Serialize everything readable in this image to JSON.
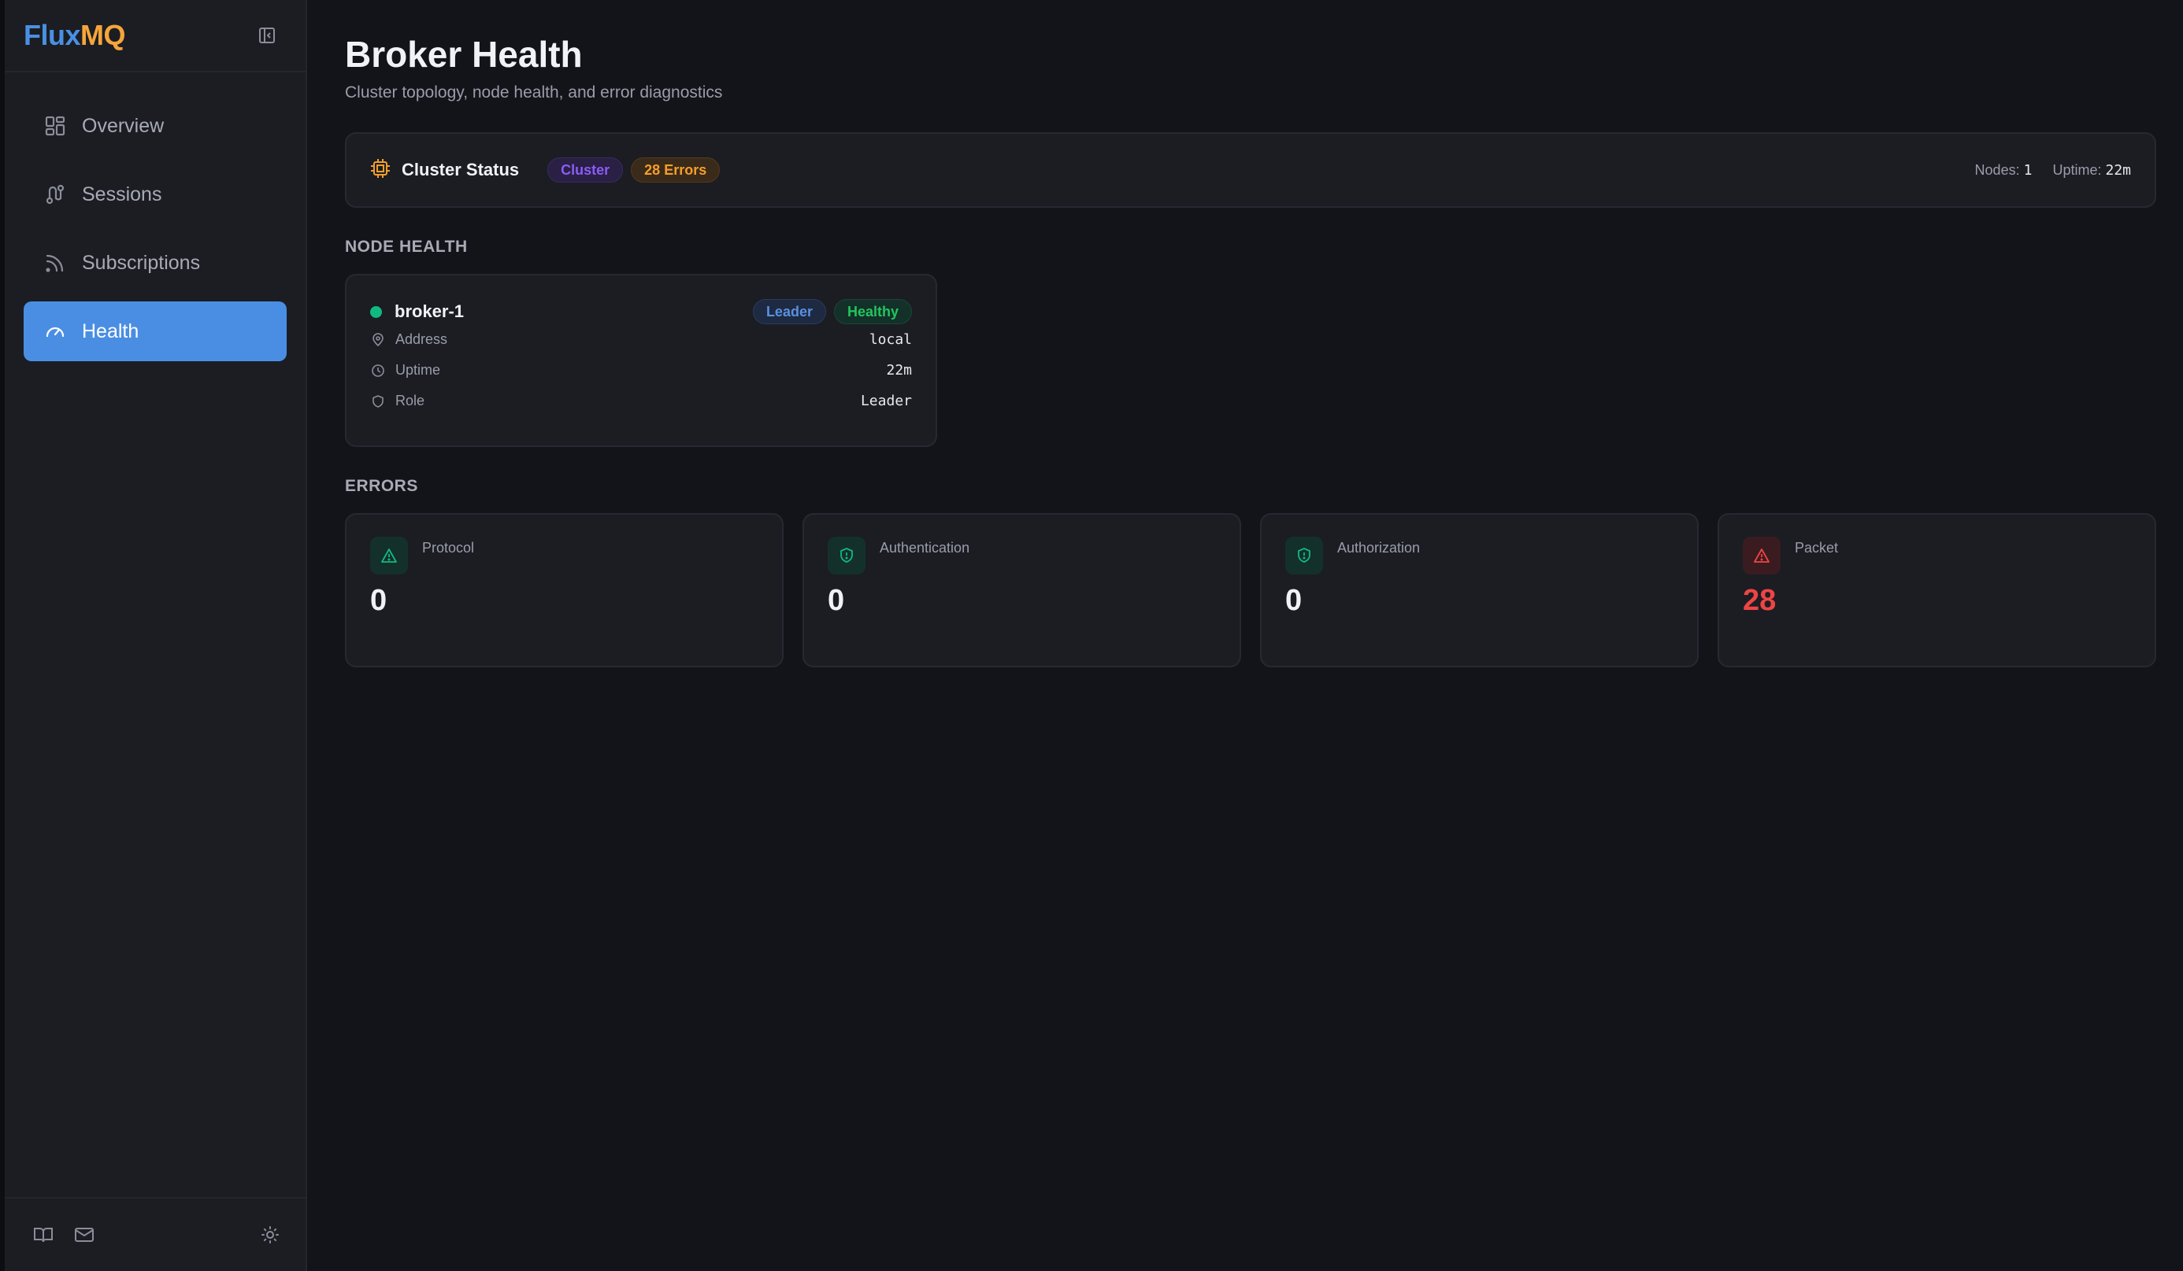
{
  "app": {
    "brand_part1": "Flux",
    "brand_part2": "MQ",
    "colors": {
      "brand_blue": "#4a90e2",
      "brand_orange": "#f5a53a",
      "accent": "#4a8ee3",
      "success": "#10b981",
      "danger": "#ef4444",
      "warning": "#f59e2b",
      "purple": "#8b5cf6"
    }
  },
  "sidebar": {
    "items": [
      {
        "label": "Overview",
        "icon": "grid-icon",
        "active": false
      },
      {
        "label": "Sessions",
        "icon": "route-icon",
        "active": false
      },
      {
        "label": "Subscriptions",
        "icon": "rss-icon",
        "active": false
      },
      {
        "label": "Health",
        "icon": "gauge-icon",
        "active": true
      }
    ],
    "footer_icons": [
      "book-icon",
      "mail-icon",
      "sun-icon"
    ]
  },
  "page": {
    "title": "Broker Health",
    "subtitle": "Cluster topology, node health, and error diagnostics"
  },
  "cluster": {
    "title": "Cluster Status",
    "badge_mode": "Cluster",
    "badge_errors": "28 Errors",
    "nodes_label": "Nodes:",
    "nodes_value": "1",
    "uptime_label": "Uptime:",
    "uptime_value": "22m"
  },
  "node_health": {
    "section_label": "NODE HEALTH",
    "node": {
      "name": "broker-1",
      "status": "healthy",
      "badge_role": "Leader",
      "badge_status": "Healthy",
      "rows": [
        {
          "label": "Address",
          "value": "local",
          "icon": "map-pin-icon"
        },
        {
          "label": "Uptime",
          "value": "22m",
          "icon": "clock-icon"
        },
        {
          "label": "Role",
          "value": "Leader",
          "icon": "shield-icon"
        }
      ]
    }
  },
  "errors": {
    "section_label": "ERRORS",
    "items": [
      {
        "label": "Protocol",
        "value": "0",
        "icon": "warning-triangle-icon",
        "severity": "ok"
      },
      {
        "label": "Authentication",
        "value": "0",
        "icon": "shield-alert-icon",
        "severity": "ok"
      },
      {
        "label": "Authorization",
        "value": "0",
        "icon": "shield-alert-icon",
        "severity": "ok"
      },
      {
        "label": "Packet",
        "value": "28",
        "icon": "warning-triangle-icon",
        "severity": "bad"
      }
    ]
  }
}
